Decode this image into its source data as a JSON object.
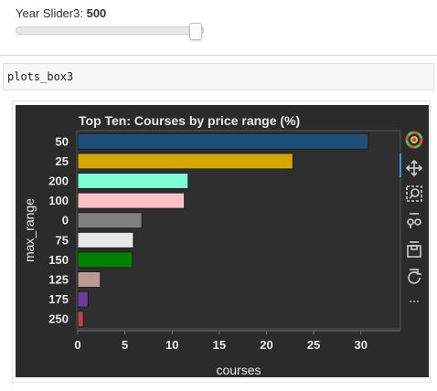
{
  "slider": {
    "label": "Year Slider3:",
    "value": "500",
    "fraction": 1.0
  },
  "code": {
    "text": "plots_box3"
  },
  "colors": {
    "plot_bg": "#2f2f2f",
    "frame_bg": "#2b2b2b",
    "text": "#eaeaea",
    "bar_outline": "#1e1e1e",
    "toolbar_active": "#3a9ad9"
  },
  "toolbar": {
    "items": [
      {
        "name": "bokeh-logo-icon"
      },
      {
        "name": "pan-icon"
      },
      {
        "name": "box-zoom-icon"
      },
      {
        "name": "wheel-zoom-icon"
      },
      {
        "name": "save-icon"
      },
      {
        "name": "reset-icon"
      },
      {
        "name": "more-icon"
      }
    ]
  },
  "chart_data": {
    "type": "bar",
    "orientation": "horizontal",
    "title": "Top Ten: Courses by price range (%)",
    "xlabel": "courses",
    "ylabel": "max_range",
    "categories": [
      "50",
      "25",
      "200",
      "100",
      "0",
      "75",
      "150",
      "125",
      "175",
      "250"
    ],
    "values": [
      30.8,
      22.8,
      11.7,
      11.3,
      6.8,
      5.9,
      5.8,
      2.4,
      1.1,
      0.6
    ],
    "colors": [
      "#1f4e79",
      "#d4a800",
      "#7fffd4",
      "#ffc0cb",
      "#808080",
      "#e8e8e8",
      "#008000",
      "#bc9a94",
      "#6a3d9a",
      "#c0405a"
    ],
    "xlim": [
      0,
      34
    ],
    "xticks": [
      "0",
      "5",
      "10",
      "15",
      "20",
      "25",
      "30"
    ],
    "grid": false,
    "legend": "none"
  }
}
